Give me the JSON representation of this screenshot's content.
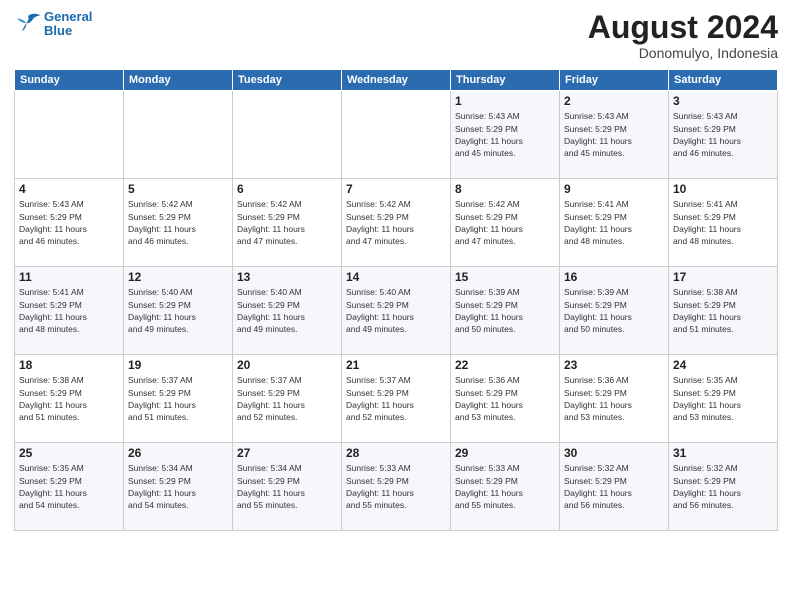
{
  "logo": {
    "line1": "General",
    "line2": "Blue"
  },
  "title": "August 2024",
  "location": "Donomulyo, Indonesia",
  "days_of_week": [
    "Sunday",
    "Monday",
    "Tuesday",
    "Wednesday",
    "Thursday",
    "Friday",
    "Saturday"
  ],
  "weeks": [
    [
      {
        "day": "",
        "info": ""
      },
      {
        "day": "",
        "info": ""
      },
      {
        "day": "",
        "info": ""
      },
      {
        "day": "",
        "info": ""
      },
      {
        "day": "1",
        "info": "Sunrise: 5:43 AM\nSunset: 5:29 PM\nDaylight: 11 hours\nand 45 minutes."
      },
      {
        "day": "2",
        "info": "Sunrise: 5:43 AM\nSunset: 5:29 PM\nDaylight: 11 hours\nand 45 minutes."
      },
      {
        "day": "3",
        "info": "Sunrise: 5:43 AM\nSunset: 5:29 PM\nDaylight: 11 hours\nand 46 minutes."
      }
    ],
    [
      {
        "day": "4",
        "info": "Sunrise: 5:43 AM\nSunset: 5:29 PM\nDaylight: 11 hours\nand 46 minutes."
      },
      {
        "day": "5",
        "info": "Sunrise: 5:42 AM\nSunset: 5:29 PM\nDaylight: 11 hours\nand 46 minutes."
      },
      {
        "day": "6",
        "info": "Sunrise: 5:42 AM\nSunset: 5:29 PM\nDaylight: 11 hours\nand 47 minutes."
      },
      {
        "day": "7",
        "info": "Sunrise: 5:42 AM\nSunset: 5:29 PM\nDaylight: 11 hours\nand 47 minutes."
      },
      {
        "day": "8",
        "info": "Sunrise: 5:42 AM\nSunset: 5:29 PM\nDaylight: 11 hours\nand 47 minutes."
      },
      {
        "day": "9",
        "info": "Sunrise: 5:41 AM\nSunset: 5:29 PM\nDaylight: 11 hours\nand 48 minutes."
      },
      {
        "day": "10",
        "info": "Sunrise: 5:41 AM\nSunset: 5:29 PM\nDaylight: 11 hours\nand 48 minutes."
      }
    ],
    [
      {
        "day": "11",
        "info": "Sunrise: 5:41 AM\nSunset: 5:29 PM\nDaylight: 11 hours\nand 48 minutes."
      },
      {
        "day": "12",
        "info": "Sunrise: 5:40 AM\nSunset: 5:29 PM\nDaylight: 11 hours\nand 49 minutes."
      },
      {
        "day": "13",
        "info": "Sunrise: 5:40 AM\nSunset: 5:29 PM\nDaylight: 11 hours\nand 49 minutes."
      },
      {
        "day": "14",
        "info": "Sunrise: 5:40 AM\nSunset: 5:29 PM\nDaylight: 11 hours\nand 49 minutes."
      },
      {
        "day": "15",
        "info": "Sunrise: 5:39 AM\nSunset: 5:29 PM\nDaylight: 11 hours\nand 50 minutes."
      },
      {
        "day": "16",
        "info": "Sunrise: 5:39 AM\nSunset: 5:29 PM\nDaylight: 11 hours\nand 50 minutes."
      },
      {
        "day": "17",
        "info": "Sunrise: 5:38 AM\nSunset: 5:29 PM\nDaylight: 11 hours\nand 51 minutes."
      }
    ],
    [
      {
        "day": "18",
        "info": "Sunrise: 5:38 AM\nSunset: 5:29 PM\nDaylight: 11 hours\nand 51 minutes."
      },
      {
        "day": "19",
        "info": "Sunrise: 5:37 AM\nSunset: 5:29 PM\nDaylight: 11 hours\nand 51 minutes."
      },
      {
        "day": "20",
        "info": "Sunrise: 5:37 AM\nSunset: 5:29 PM\nDaylight: 11 hours\nand 52 minutes."
      },
      {
        "day": "21",
        "info": "Sunrise: 5:37 AM\nSunset: 5:29 PM\nDaylight: 11 hours\nand 52 minutes."
      },
      {
        "day": "22",
        "info": "Sunrise: 5:36 AM\nSunset: 5:29 PM\nDaylight: 11 hours\nand 53 minutes."
      },
      {
        "day": "23",
        "info": "Sunrise: 5:36 AM\nSunset: 5:29 PM\nDaylight: 11 hours\nand 53 minutes."
      },
      {
        "day": "24",
        "info": "Sunrise: 5:35 AM\nSunset: 5:29 PM\nDaylight: 11 hours\nand 53 minutes."
      }
    ],
    [
      {
        "day": "25",
        "info": "Sunrise: 5:35 AM\nSunset: 5:29 PM\nDaylight: 11 hours\nand 54 minutes."
      },
      {
        "day": "26",
        "info": "Sunrise: 5:34 AM\nSunset: 5:29 PM\nDaylight: 11 hours\nand 54 minutes."
      },
      {
        "day": "27",
        "info": "Sunrise: 5:34 AM\nSunset: 5:29 PM\nDaylight: 11 hours\nand 55 minutes."
      },
      {
        "day": "28",
        "info": "Sunrise: 5:33 AM\nSunset: 5:29 PM\nDaylight: 11 hours\nand 55 minutes."
      },
      {
        "day": "29",
        "info": "Sunrise: 5:33 AM\nSunset: 5:29 PM\nDaylight: 11 hours\nand 55 minutes."
      },
      {
        "day": "30",
        "info": "Sunrise: 5:32 AM\nSunset: 5:29 PM\nDaylight: 11 hours\nand 56 minutes."
      },
      {
        "day": "31",
        "info": "Sunrise: 5:32 AM\nSunset: 5:29 PM\nDaylight: 11 hours\nand 56 minutes."
      }
    ]
  ]
}
